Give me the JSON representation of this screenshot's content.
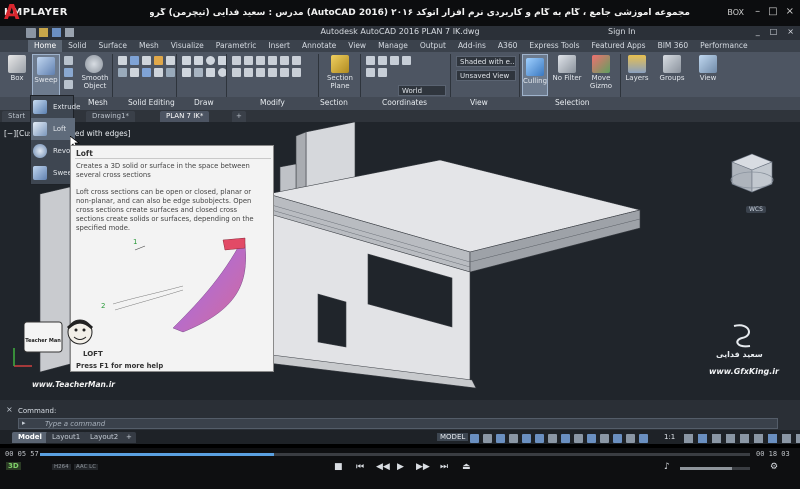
{
  "player": {
    "logo": "KMPLAYER",
    "title": "مجموعه آموزشی جامع ، گام به گام و کاربردی نرم افزار اتوکد ۲۰۱۶ (AutoCAD 2016) مدرس : سعید فدایی (تیچرمن) گروه آموزشی پادشاه گرافیست ها",
    "box_label": "BOX",
    "time_elapsed": "00 05 57",
    "time_total": "00 18 03",
    "progress": 0.33,
    "tags": [
      "H264",
      "AAC LC"
    ],
    "mode_3d": "3D"
  },
  "acad": {
    "title": "Autodesk AutoCAD 2016   PLAN 7 IK.dwg",
    "sign_in": "Sign In",
    "window_controls": [
      "_",
      "□",
      "×"
    ]
  },
  "ribbon_tabs": [
    "Home",
    "Solid",
    "Surface",
    "Mesh",
    "Visualize",
    "Parametric",
    "Insert",
    "Annotate",
    "View",
    "Manage",
    "Output",
    "Add-ins",
    "A360",
    "Express Tools",
    "Featured Apps",
    "BIM 360",
    "Performance"
  ],
  "ribbon": {
    "box": "Box",
    "sweep": "Sweep",
    "smooth_object": "Smooth Object",
    "section_plane": "Section Plane",
    "culling": "Culling",
    "no_filter": "No Filter",
    "move_gizmo": "Move Gizmo",
    "layers": "Layers",
    "groups": "Groups",
    "view": "View",
    "visual_style": "Shaded with e...",
    "view_unsaved": "Unsaved View",
    "ucs_world": "World",
    "panels": [
      "Mesh",
      "Solid Editing",
      "Draw",
      "Modify",
      "Section",
      "Coordinates",
      "View",
      "Selection"
    ]
  },
  "file_tabs": [
    "Start",
    "Drawing1*",
    "PLAN 7 IK*"
  ],
  "viewport": {
    "label": "[−][Custom] [Shaded with edges]",
    "wcs": "WCS"
  },
  "dropdown": [
    "Extrude",
    "Loft",
    "Revolve",
    "Sweep"
  ],
  "tooltip": {
    "title": "Loft",
    "desc": "Creates a 3D solid or surface in the space between several cross sections",
    "body": "Loft cross sections can be open or closed, planar or non-planar, and can also be edge subobjects. Open cross sections create surfaces and closed cross sections create solids or surfaces, depending on the specified mode.",
    "help": "Press F1 for more help",
    "markers": [
      "1",
      "2"
    ],
    "loft_label": "LOFT"
  },
  "watermark": {
    "name": "سعید فدایی",
    "site": "www.GfxKing.ir",
    "teacher_site": "www.TeacherMan.ir",
    "teacher_badge": "Teacher Man"
  },
  "command": {
    "history": "Command:",
    "placeholder": "Type a command"
  },
  "layout_tabs": [
    "Model",
    "Layout1",
    "Layout2"
  ],
  "status": {
    "model": "MODEL",
    "scale": "1:1"
  },
  "colors": {
    "ribbon": "#4d5562",
    "viewport": "#20252b",
    "accent_red": "#d8262e",
    "progress": "#5aa0e0"
  }
}
